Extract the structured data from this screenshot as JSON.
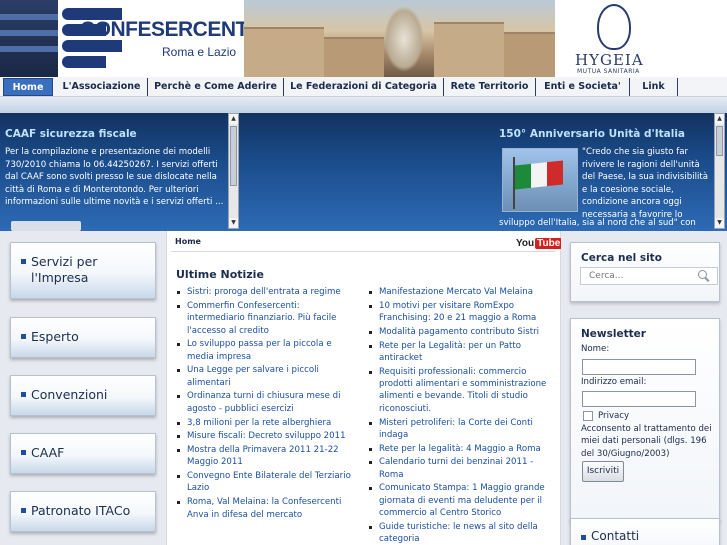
{
  "header": {
    "logo_name": "CONFESERCENTI",
    "logo_sub": "Roma e Lazio",
    "partner_name": "HYGEIA",
    "partner_sub": "MUTUA SANITARIA"
  },
  "nav": {
    "items": [
      {
        "label": "Home",
        "active": true
      },
      {
        "label": "L'Associazione"
      },
      {
        "label": "Perchè e Come Aderire"
      },
      {
        "label": "Le Federazioni di Categoria"
      },
      {
        "label": "Rete Territorio"
      },
      {
        "label": "Enti e Societa'"
      },
      {
        "label": "Link"
      }
    ]
  },
  "caaf": {
    "title": "CAAF sicurezza fiscale",
    "text": "Per la compilazione e presentazione dei modelli 730/2010 chiama lo 06.44250267.  I servizi offerti dal CAAF sono svolti presso le sue dislocate nella città di Roma e di Monterotondo. Per ulteriori informazioni sulle ultime novità e i servizi offerti ..."
  },
  "anniversary": {
    "title": "150° Anniversario Unità d'Italia",
    "text": "\"Credo che sia giusto far rivivere le ragioni dell'unità del Paese, la sua indivisibilità e la coesione sociale, condizione ancora oggi necessaria a favorire lo",
    "text_tail": "sviluppo dell'Italia, sia al nord che al sud\" con"
  },
  "left_sidebar": {
    "items": [
      {
        "label_1": "Servizi per",
        "label_2": "l'Impresa"
      },
      {
        "label_1": "Esperto"
      },
      {
        "label_1": "Convenzioni"
      },
      {
        "label_1": "CAAF"
      },
      {
        "label_1": "Patronato ITACo"
      }
    ]
  },
  "main": {
    "breadcrumb": "Home",
    "youtube_label_1": "You",
    "youtube_label_2": "Tube",
    "news_title": "Ultime Notizie",
    "news_left": [
      "Sistri: proroga dell'entrata a regime",
      "Commerfin Confesercenti: intermediario finanziario. Più facile l'accesso al credito",
      "Lo sviluppo passa per la piccola e media impresa",
      "Una Legge per salvare i piccoli alimentari",
      "Ordinanza turni di chiusura mese di agosto - pubblici esercizi",
      "3,8 milioni per la rete alberghiera",
      "Misure fiscali: Decreto sviluppo 2011",
      "Mostra della Primavera 2011 21-22 Maggio 2011",
      "Convegno Ente Bilaterale del Terziario Lazio",
      "Roma, Val Melaina: la Confesercenti Anva in difesa del mercato"
    ],
    "news_right": [
      "Manifestazione Mercato Val Melaina",
      "10 motivi per visitare RomExpo Franchising: 20 e 21 maggio a Roma",
      "Modalità pagamento contributo Sistri",
      "Rete per la Legalità: per un Patto antiracket",
      "Requisiti professionali: commercio prodotti alimentari e somministrazione alimenti e bevande. Titoli di studio riconosciuti.",
      "Misteri petroliferi: la Corte dei Conti indaga",
      "Rete per la legalità: 4 Maggio a Roma",
      "Calendario turni dei benzinai 2011 - Roma",
      "Comunicato Stampa: 1 Maggio grande giornata di eventi ma deludente per il commercio al Centro Storico",
      "Guide turistiche: le news al sito della categoria"
    ]
  },
  "right_sidebar": {
    "search_title": "Cerca nel sito",
    "search_placeholder": "Cerca...",
    "newsletter_title": "Newsletter",
    "name_label": "Nome:",
    "email_label": "Indirizzo email:",
    "privacy_label": "Privacy",
    "terms": "Acconsento al trattamento dei miei dati personali (dlgs. 196 del 30/Giugno/2003)",
    "submit_label": "Iscriviti",
    "contacts_title": "Contatti"
  },
  "colors": {
    "accent": "#3a6fc0",
    "brand_dark": "#1e3a78",
    "link": "#1a4fa2"
  }
}
